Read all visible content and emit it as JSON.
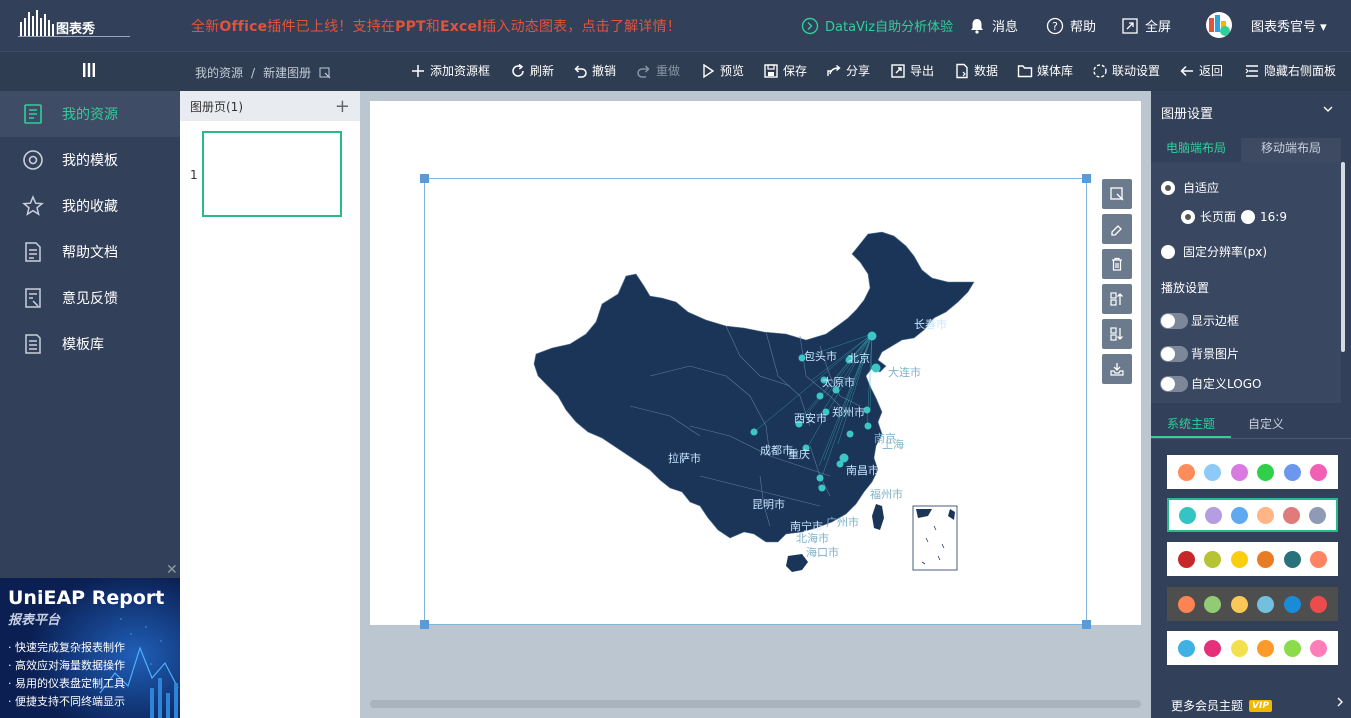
{
  "header": {
    "logo_text": "图表秀",
    "announcement_prefix": "全新",
    "announcement_office": "Office",
    "announcement_mid": "插件已上线！支持在",
    "announcement_ppt": "PPT",
    "announcement_and": "和",
    "announcement_excel": "Excel",
    "announcement_suffix": "插入动态图表，点击了解详情！",
    "dataviz_label": "DataViz自助分析体验",
    "messages_label": "消息",
    "help_label": "帮助",
    "fullscreen_label": "全屏",
    "account_label": "图表秀官号"
  },
  "breadcrumb": {
    "root": "我的资源",
    "separator": "/",
    "current": "新建图册"
  },
  "toolbar": {
    "add_frame": "添加资源框",
    "refresh": "刷新",
    "undo": "撤销",
    "redo": "重做",
    "preview": "预览",
    "save": "保存",
    "share": "分享",
    "export": "导出",
    "data": "数据",
    "media": "媒体库",
    "linkage": "联动设置",
    "back": "返回",
    "hide_panel": "隐藏右侧面板"
  },
  "sidebar": {
    "items": [
      {
        "label": "我的资源",
        "icon": "document-icon",
        "active": true
      },
      {
        "label": "我的模板",
        "icon": "template-icon",
        "active": false
      },
      {
        "label": "我的收藏",
        "icon": "star-icon",
        "active": false
      },
      {
        "label": "帮助文档",
        "icon": "help-doc-icon",
        "active": false
      },
      {
        "label": "意见反馈",
        "icon": "feedback-icon",
        "active": false
      },
      {
        "label": "模板库",
        "icon": "library-icon",
        "active": false
      }
    ]
  },
  "ad": {
    "close": "✕",
    "title": "UniEAP Report",
    "subtitle": "报表平台",
    "lines": [
      "快速完成复杂报表制作",
      "高效应对海量数据操作",
      "易用的仪表盘定制工具",
      "便捷支持不同终端显示"
    ]
  },
  "pages_panel": {
    "title": "图册页(1)",
    "add": "+",
    "thumb_number": "1"
  },
  "map": {
    "city_labels": [
      "长春市",
      "包头市",
      "北京",
      "大连市",
      "太原市",
      "郑州市",
      "西安市",
      "南京",
      "上海",
      "拉萨市",
      "成都市",
      "重庆",
      "南昌市",
      "福州市",
      "昆明市",
      "南宁市",
      "广州市",
      "北海市",
      "海口市"
    ]
  },
  "right_panel": {
    "title": "图册设置",
    "tab_pc": "电脑端布局",
    "tab_mobile": "移动端布局",
    "auto_fit": "自适应",
    "long_page": "长页面",
    "ratio_16_9": "16:9",
    "fixed_res": "固定分辨率(px)",
    "play_settings": "播放设置",
    "show_border": "显示边框",
    "bg_image": "背景图片",
    "custom_logo": "自定义LOGO",
    "theme_tab_system": "系统主题",
    "theme_tab_custom": "自定义",
    "more_themes": "更多会员主题",
    "vip": "VIP"
  },
  "themes": [
    {
      "bg": "#ffffff",
      "colors": [
        "#ff8c5a",
        "#8dcaf7",
        "#d87ae0",
        "#2fcf4a",
        "#6d97ef",
        "#f060b4"
      ]
    },
    {
      "bg": "#ffffff",
      "colors": [
        "#34c4c4",
        "#b49de0",
        "#5ea9ef",
        "#ffb584",
        "#e07b7b",
        "#8f9bb5"
      ],
      "selected": true
    },
    {
      "bg": "#ffffff",
      "colors": [
        "#c62828",
        "#b5c334",
        "#fcce10",
        "#e87c25",
        "#27727b",
        "#fe8463"
      ]
    },
    {
      "bg": "#4e4e4e",
      "colors": [
        "#fc8452",
        "#91cc75",
        "#fac858",
        "#73c0de",
        "#1a8bd6",
        "#ee4c4c"
      ]
    },
    {
      "bg": "#ffffff",
      "colors": [
        "#3fb1e3",
        "#e5317a",
        "#f4e04d",
        "#ff9a2a",
        "#8bdc4b",
        "#ff7eb9"
      ]
    }
  ],
  "colors": {
    "accent": "#2fcf9a",
    "topbar": "#33405a",
    "announcement": "#e2533c",
    "map_fill": "#1b3558",
    "city_dot": "#3ec6c6"
  }
}
